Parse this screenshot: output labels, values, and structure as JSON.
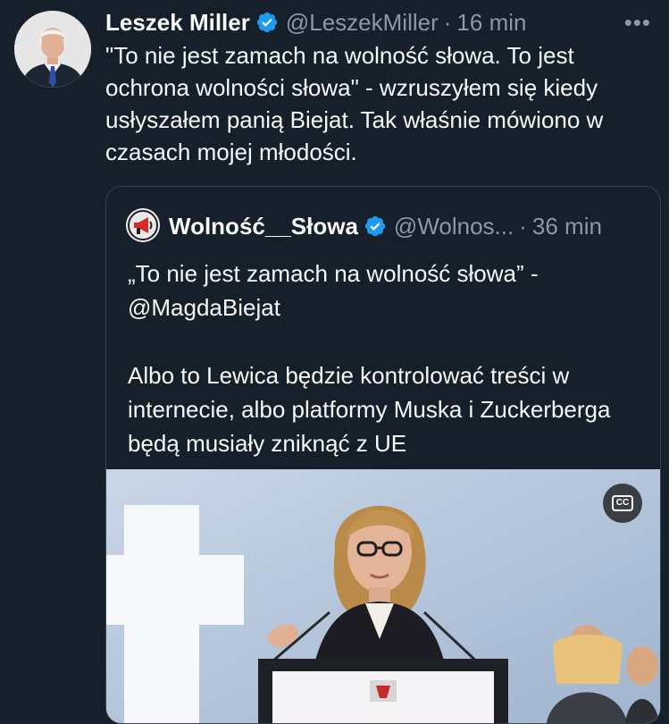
{
  "post": {
    "author_name": "Leszek Miller",
    "author_handle": "@LeszekMiller",
    "separator": "·",
    "time": "16 min",
    "more_label": "•••",
    "text": "\"To nie jest zamach na wolność słowa. To jest ochrona wolności słowa\" - wzruszyłem się kiedy usłyszałem panią Biejat. Tak właśnie mówiono w czasach mojej młodości."
  },
  "quote": {
    "author_name": "Wolność__Słowa",
    "author_handle": "@Wolnos...",
    "separator": "·",
    "time": "36 min",
    "text": "„To nie jest zamach na wolność słowa” - @MagdaBiejat\n\nAlbo to Lewica będzie kontrolować treści w internecie, albo platformy Muska i Zuckerberga będą musiały zniknąć z UE",
    "media": {
      "cc_label": "CC"
    }
  },
  "icons": {
    "verified": "verified-badge-icon",
    "more": "more-options-icon",
    "captions": "closed-captions-icon"
  },
  "colors": {
    "background": "#15202b",
    "text_primary": "#f7f9f9",
    "text_secondary": "#8b98a5",
    "verified_blue": "#1d9bf0",
    "border": "#38444d"
  }
}
